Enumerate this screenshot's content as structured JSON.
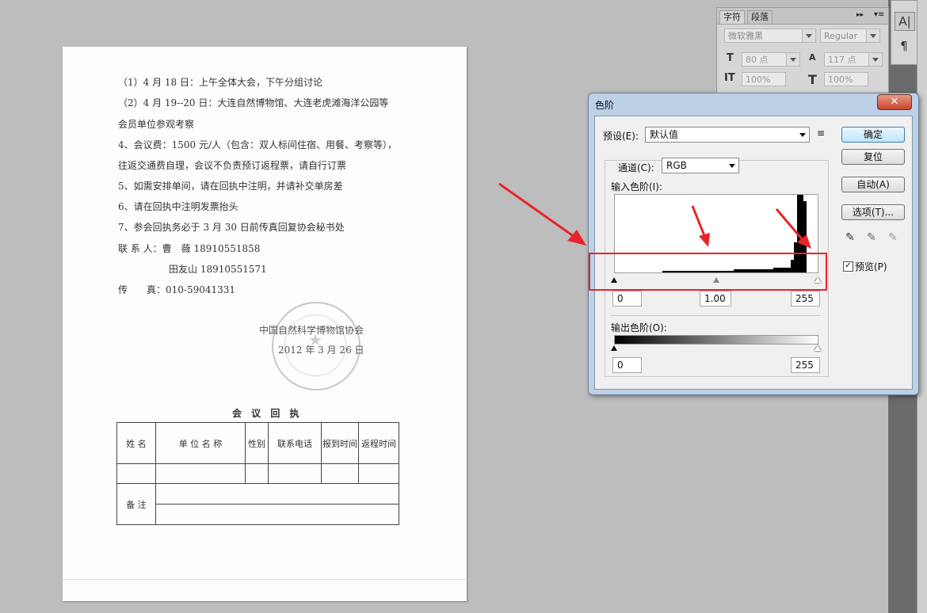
{
  "document": {
    "lines": [
      "（1）4 月 18 日：上午全体大会，下午分组讨论",
      "（2）4 月 19--20 日：大连自然博物馆、大连老虎滩海洋公园等",
      "会员单位参观考察",
      "4、会议费：1500 元/人（包含：双人标间住宿、用餐、考察等），",
      "往返交通费自理，会议不负责预订返程票，请自行订票",
      "5、如需安排单间，请在回执中注明，并请补交单房差",
      "6、请在回执中注明发票抬头",
      "7、参会回执务必于 3 月 30 日前传真回复协会秘书处",
      "联 系 人：曹　薇 18910551858",
      "田友山 18910551571",
      "传　　真：010-59041331"
    ],
    "org": "中国自然科学博物馆协会",
    "date": "2012 年 3 月 26 日",
    "stamp_text": "中国自然科学博物馆协会",
    "reply_title": "会 议 回 执",
    "table_headers": [
      "姓 名",
      "单 位 名 称",
      "性别",
      "联系电话",
      "报到时间",
      "返程时间"
    ],
    "remark_label": "备 注"
  },
  "char_panel": {
    "tab_char": "字符",
    "tab_para": "段落",
    "font_family": "微软雅黑",
    "font_style": "Regular",
    "font_size": "80 点",
    "leading": "117 点",
    "vscale": "100%",
    "hscale": "100%",
    "size_icon_label": "T",
    "leading_icon_label": "A",
    "vscale_icon_label": "IT",
    "hscale_icon_label": "T"
  },
  "levels": {
    "title": "色阶",
    "close": "✕",
    "preset_label": "预设(E):",
    "preset_value": "默认值",
    "channel_label": "通道(C):",
    "channel_value": "RGB",
    "input_levels_label": "输入色阶(I):",
    "input_black": "0",
    "input_gamma": "1.00",
    "input_white": "255",
    "output_levels_label": "输出色阶(O):",
    "output_black": "0",
    "output_white": "255",
    "btn_ok": "确定",
    "btn_reset": "复位",
    "btn_auto": "自动(A)",
    "btn_options": "选项(T)...",
    "preview_label": "预览(P)",
    "preview_checked": true
  }
}
